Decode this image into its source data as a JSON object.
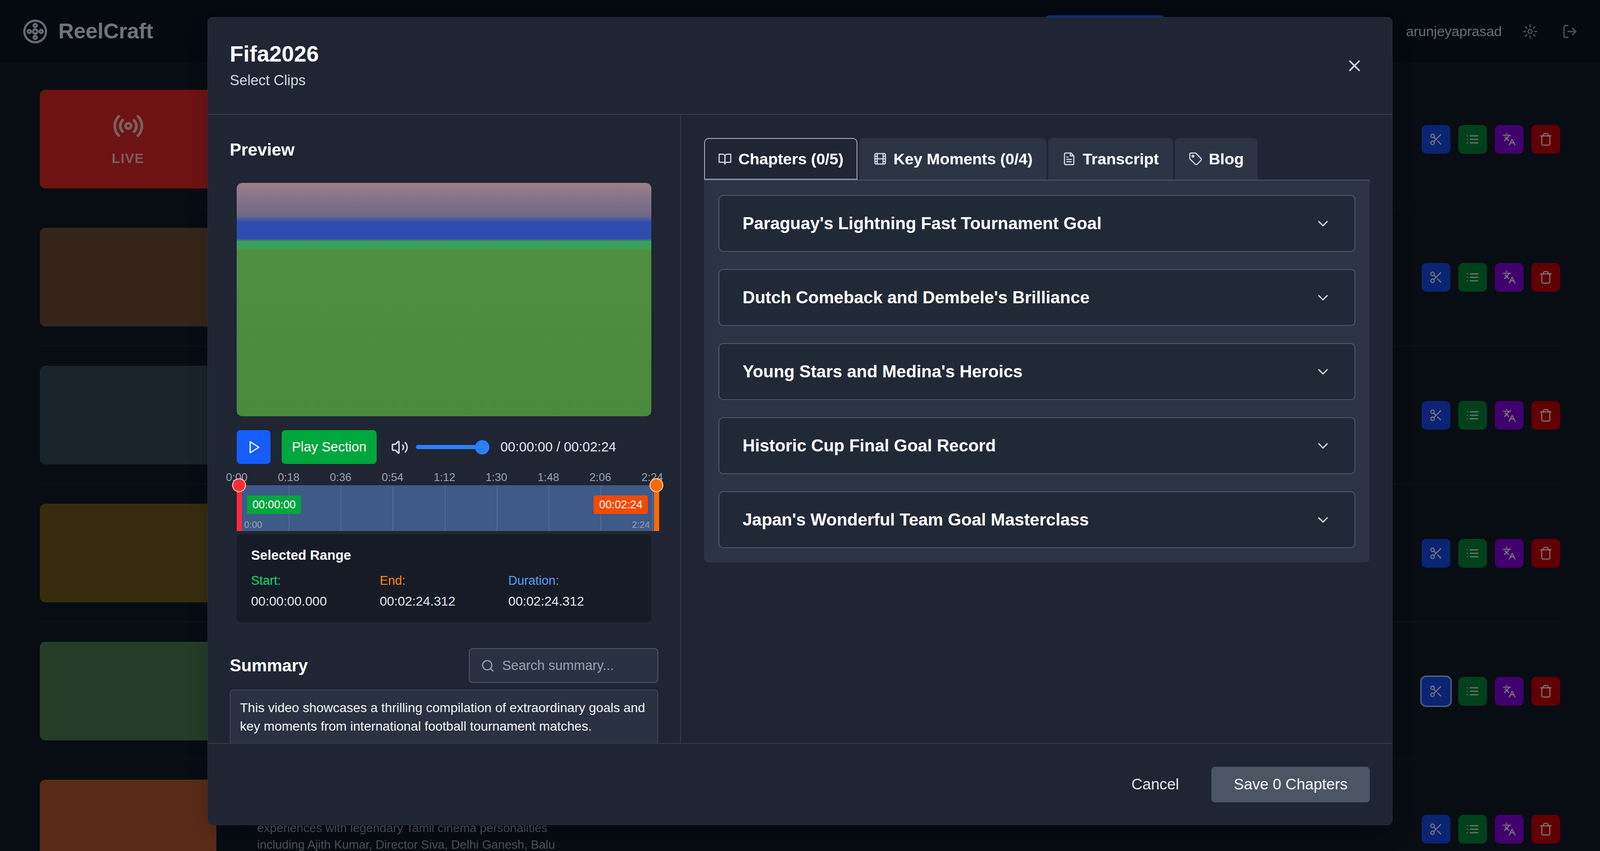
{
  "app": {
    "brand": "ReelCraft",
    "user": "arunjeyaprasad"
  },
  "videos": [
    {
      "kind": "live",
      "badge": "LIVE",
      "color": "#dc2626",
      "description": [],
      "focused": false
    },
    {
      "kind": "video",
      "color": "#6b4a35",
      "description": [],
      "focused": false
    },
    {
      "kind": "video",
      "color": "#2f4a55",
      "description": [],
      "focused": false
    },
    {
      "kind": "video",
      "color": "#6e5a1c",
      "description": [],
      "focused": false
    },
    {
      "kind": "video",
      "color": "#4a7a4f",
      "description": [],
      "focused": true
    },
    {
      "kind": "video",
      "color": "#b5572e",
      "description": [
        "experiences with legendary Tamil cinema personalities",
        "including Ajith Kumar, Director Siva, Delhi Ganesh, Balu"
      ],
      "focused": false
    }
  ],
  "modal": {
    "title": "Fifa2026",
    "subtitle": "Select Clips",
    "preview": {
      "heading": "Preview",
      "play_section": "Play Section",
      "volume": {
        "level": 1
      },
      "time": "00:00:00 / 00:02:24",
      "timeline": {
        "ticks": [
          "0:00",
          "0:18",
          "0:36",
          "0:54",
          "1:12",
          "1:30",
          "1:48",
          "2:06",
          "2:24"
        ],
        "start_badge": "00:00:00",
        "end_badge": "00:02:24",
        "start_label": "0:00",
        "end_label": "2:24",
        "start": 0,
        "end": 1
      },
      "range": {
        "heading": "Selected Range",
        "start_label": "Start:",
        "start": "00:00:00.000",
        "end_label": "End:",
        "end": "00:02:24.312",
        "duration_label": "Duration:",
        "duration": "00:02:24.312"
      }
    },
    "summary": {
      "heading": "Summary",
      "search_placeholder": "Search summary...",
      "text": "This video showcases a thrilling compilation of extraordinary goals and key moments from international football tournament matches."
    },
    "tabs": [
      {
        "label": "Chapters (0/5)",
        "selected": true
      },
      {
        "label": "Key Moments (0/4)",
        "selected": false
      },
      {
        "label": "Transcript",
        "selected": false
      },
      {
        "label": "Blog",
        "selected": false
      }
    ],
    "chapters": [
      {
        "title": "Paraguay's Lightning Fast Tournament Goal",
        "expanded": false
      },
      {
        "title": "Dutch Comeback and Dembele's Brilliance",
        "expanded": false
      },
      {
        "title": "Young Stars and Medina's Heroics",
        "expanded": false
      },
      {
        "title": "Historic Cup Final Goal Record",
        "expanded": false
      },
      {
        "title": "Japan's Wonderful Team Goal Masterclass",
        "expanded": false
      }
    ],
    "footer": {
      "cancel": "Cancel",
      "save": "Save 0 Chapters",
      "save_disabled": true
    }
  }
}
